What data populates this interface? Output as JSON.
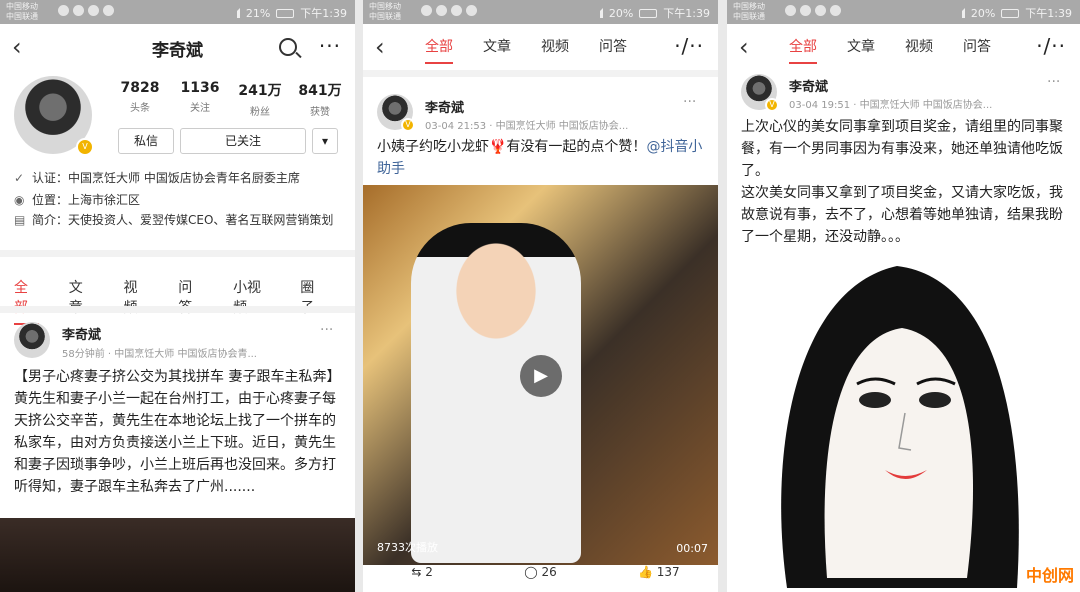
{
  "status": {
    "carrier1": "中国移动",
    "carrier2": "中国联通",
    "battery_p1": "21%",
    "battery_p23": "20%",
    "time": "下午1:39"
  },
  "profile": {
    "name": "李奇斌",
    "stats": [
      {
        "value": "7828",
        "label": "头条"
      },
      {
        "value": "1136",
        "label": "关注"
      },
      {
        "value": "241万",
        "label": "粉丝"
      },
      {
        "value": "841万",
        "label": "获赞"
      }
    ],
    "msg_btn": "私信",
    "follow_btn": "已关注",
    "cert_label": "认证：",
    "cert": "中国烹饪大师 中国饭店协会青年名厨委主席",
    "loc_label": "位置：",
    "loc": "上海市徐汇区",
    "bio_label": "简介：",
    "bio": "天使投资人、爱翌传媒CEO、著名互联网营销策划"
  },
  "tabs_p1": [
    "全部",
    "文章",
    "视频",
    "问答",
    "小视频",
    "圈子"
  ],
  "tabs_nav": [
    "全部",
    "文章",
    "视频",
    "问答"
  ],
  "post1": {
    "author": "李奇斌",
    "meta": "58分钟前 · 中国烹饪大师 中国饭店协会青...",
    "text": "【男子心疼妻子挤公交为其找拼车 妻子跟车主私奔】黄先生和妻子小兰一起在台州打工，由于心疼妻子每天挤公交辛苦，黄先生在本地论坛上找了一个拼车的私家车，由对方负责接送小兰上下班。近日，黄先生和妻子因琐事争吵，小兰上班后再也没回来。多方打听得知，妻子跟车主私奔去了广州......."
  },
  "post2": {
    "author": "李奇斌",
    "meta": "03-04 21:53 · 中国烹饪大师 中国饭店协会...",
    "text": "小姨子约吃小龙虾🦞有没有一起的点个赞！",
    "link": "@抖音小助手",
    "plays": "8733次播放",
    "duration": "00:07",
    "shares": "2",
    "comments": "26",
    "likes": "137"
  },
  "post3": {
    "author": "李奇斌",
    "meta": "03-04 19:51 · 中国烹饪大师 中国饭店协会...",
    "text1": "上次心仪的美女同事拿到项目奖金，请组里的同事聚餐，有一个男同事因为有事没来，她还单独请他吃饭了。",
    "text2": "这次美女同事又拿到了项目奖金，又请大家吃饭，我故意说有事，去不了，心想着等她单独请，结果我盼了一个星期，还没动静。。。"
  },
  "watermark": "中创网"
}
